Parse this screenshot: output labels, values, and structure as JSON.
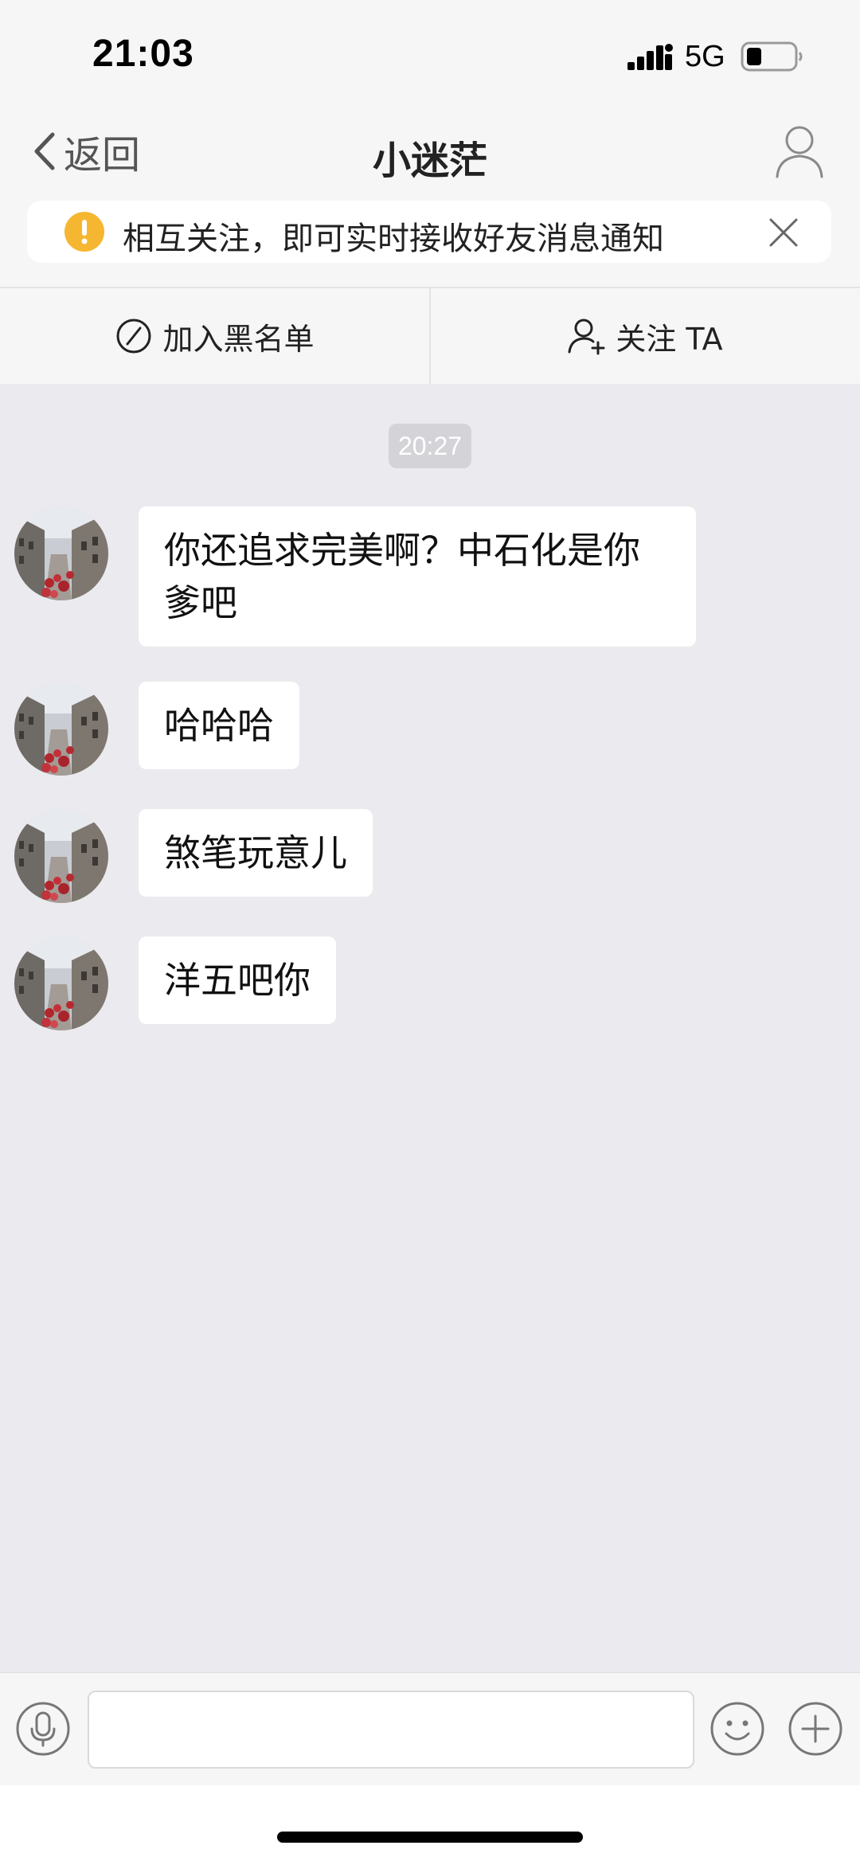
{
  "status_bar": {
    "time": "21:03",
    "network": "5G",
    "icons": [
      "signal-bars-icon",
      "battery-icon"
    ]
  },
  "nav": {
    "back_label": "返回",
    "title": "小迷茫",
    "icons": [
      "chevron-left-icon",
      "profile-icon"
    ]
  },
  "notice": {
    "text": "相互关注，即可实时接收好友消息通知",
    "icons": [
      "alert-icon",
      "close-icon"
    ],
    "alert_color": "#f5b731"
  },
  "actions": {
    "block_label": "加入黑名单",
    "follow_label": "关注 TA",
    "icons": [
      "block-icon",
      "add-user-icon"
    ]
  },
  "chat": {
    "timestamp": "20:27",
    "messages": [
      {
        "text_line1": "你还追求完美啊？中石化是你",
        "text_line2": "爹吧"
      },
      {
        "text": "哈哈哈"
      },
      {
        "text": "煞笔玩意儿"
      },
      {
        "text": "洋五吧你"
      }
    ]
  },
  "composer": {
    "input_value": "",
    "placeholder": "",
    "icons": [
      "microphone-icon",
      "emoji-icon",
      "plus-icon"
    ]
  },
  "colors": {
    "chat_background": "#ebebef",
    "bubble_background": "#ffffff",
    "chrome_background": "#f6f6f6"
  }
}
